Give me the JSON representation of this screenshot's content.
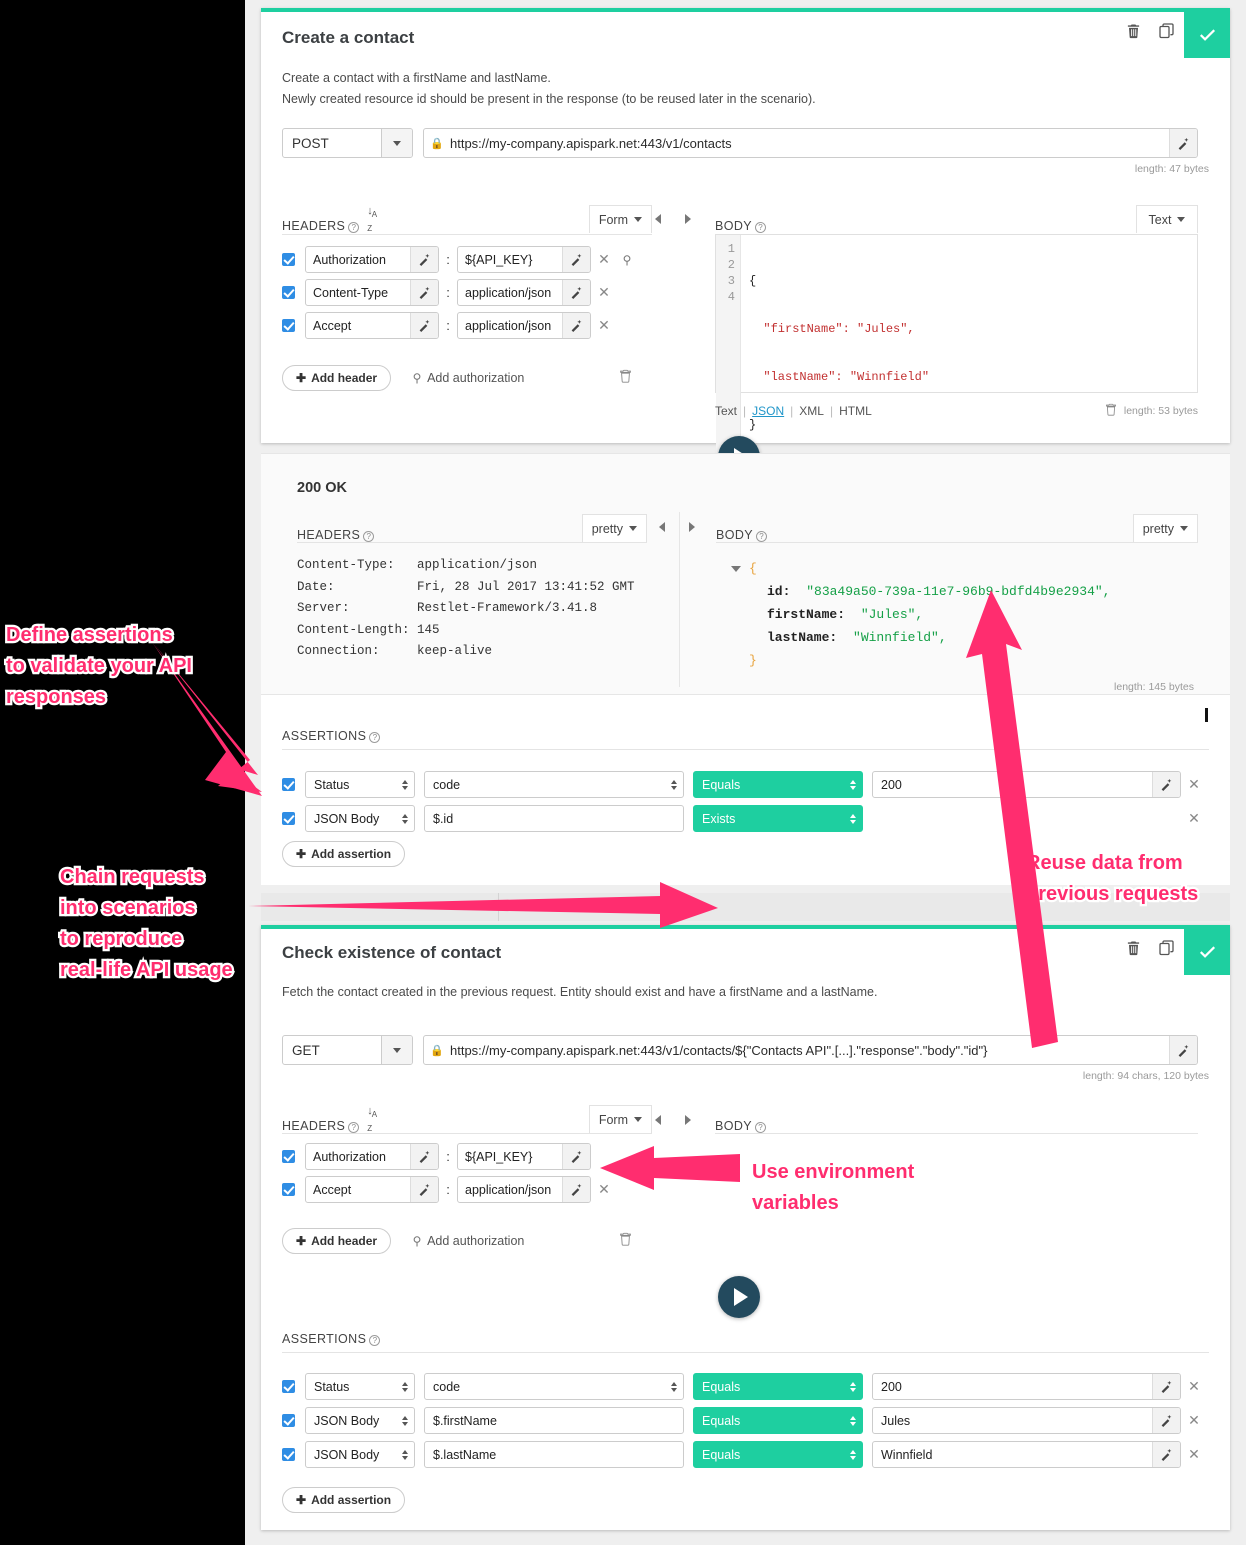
{
  "requests": [
    {
      "title": "Create a contact",
      "description_line1": "Create a contact with a firstName and lastName.",
      "description_line2": "Newly created resource id should be present in the response (to be reused later in the scenario).",
      "method": "POST",
      "url": "https://my-company.apispark.net:443/v1/contacts",
      "url_length_note": "length: 47 bytes",
      "headers_label": "HEADERS",
      "headers_mode": "Form",
      "headers": [
        {
          "checked": true,
          "name": "Authorization",
          "value": "${API_KEY}",
          "has_delete": true,
          "has_key_icon": true
        },
        {
          "checked": true,
          "name": "Content-Type",
          "value": "application/json",
          "has_delete": true,
          "has_key_icon": false
        },
        {
          "checked": true,
          "name": "Accept",
          "value": "application/json",
          "has_delete": true,
          "has_key_icon": false
        }
      ],
      "add_header_label": "Add header",
      "add_authorization_label": "Add authorization",
      "body_label": "BODY",
      "body_mode": "Text",
      "body_lines": [
        "{",
        "  \"firstName\": \"Jules\",",
        "  \"lastName\": \"Winnfield\"",
        "}"
      ],
      "body_line_numbers": [
        "1",
        "2",
        "3",
        "4"
      ],
      "body_formats": [
        "Text",
        "JSON",
        "XML",
        "HTML"
      ],
      "body_active_format": "JSON",
      "body_length_note": "length: 53 bytes",
      "response": {
        "status": "200 OK",
        "headers_label": "HEADERS",
        "headers_mode": "pretty",
        "headers": [
          {
            "name": "Content-Type:",
            "value": "application/json"
          },
          {
            "name": "Date:",
            "value": "Fri, 28 Jul 2017 13:41:52 GMT"
          },
          {
            "name": "Server:",
            "value": "Restlet-Framework/3.41.8"
          },
          {
            "name": "Content-Length:",
            "value": "145"
          },
          {
            "name": "Connection:",
            "value": "keep-alive"
          }
        ],
        "body_label": "BODY",
        "body_mode": "pretty",
        "body_fields": [
          {
            "key": "id:",
            "value": "\"83a49a50-739a-11e7-96b9-bdfd4b9e2934\","
          },
          {
            "key": "firstName:",
            "value": "\"Jules\","
          },
          {
            "key": "lastName:",
            "value": "\"Winnfield\","
          }
        ],
        "body_open_brace": "{",
        "body_close_brace": "}",
        "body_length_note": "length: 145 bytes"
      },
      "assertions_label": "ASSERTIONS",
      "assertions": [
        {
          "checked": true,
          "source": "Status",
          "path": "code",
          "operator": "Equals",
          "value": "200",
          "has_value": true,
          "has_wand": true,
          "has_delete": true
        },
        {
          "checked": true,
          "source": "JSON Body",
          "path": "$.id",
          "operator": "Exists",
          "value": "",
          "has_value": false,
          "has_wand": false,
          "has_delete": true
        }
      ],
      "add_assertion_label": "Add assertion"
    },
    {
      "title": "Check existence of contact",
      "description_line1": "Fetch the contact created in the previous request. Entity should exist and have a firstName and a lastName.",
      "method": "GET",
      "url": "https://my-company.apispark.net:443/v1/contacts/${\"Contacts API\".[...].\"response\".\"body\".\"id\"}",
      "url_length_note": "length: 94 chars, 120 bytes",
      "headers_label": "HEADERS",
      "headers_mode": "Form",
      "headers": [
        {
          "checked": true,
          "name": "Authorization",
          "value": "${API_KEY}",
          "has_delete": false,
          "has_key_icon": false
        },
        {
          "checked": true,
          "name": "Accept",
          "value": "application/json",
          "has_delete": true,
          "has_key_icon": false
        }
      ],
      "add_header_label": "Add header",
      "add_authorization_label": "Add authorization",
      "body_label": "BODY",
      "assertions_label": "ASSERTIONS",
      "assertions": [
        {
          "checked": true,
          "source": "Status",
          "path": "code",
          "operator": "Equals",
          "value": "200",
          "has_value": true,
          "has_wand": true,
          "has_delete": true
        },
        {
          "checked": true,
          "source": "JSON Body",
          "path": "$.firstName",
          "operator": "Equals",
          "value": "Jules",
          "has_value": true,
          "has_wand": true,
          "has_delete": true
        },
        {
          "checked": true,
          "source": "JSON Body",
          "path": "$.lastName",
          "operator": "Equals",
          "value": "Winnfield",
          "has_value": true,
          "has_wand": true,
          "has_delete": true
        }
      ],
      "add_assertion_label": "Add assertion"
    }
  ],
  "annotations": [
    {
      "id": "assertions-callout",
      "text": "Define assertions\nto validate your API\nresponses"
    },
    {
      "id": "chain-callout",
      "text": "Chain requests\ninto scenarios\nto reproduce\nreal-life API usage"
    },
    {
      "id": "reuse-callout",
      "text": "Reuse data from\nprevious requests"
    },
    {
      "id": "envvars-callout",
      "text": "Use environment\nvariables"
    }
  ],
  "colors": {
    "accent_teal": "#1ecfa0",
    "annotation_pink": "#ff2d6f",
    "play_navy": "#234a5e",
    "checkbox_blue": "#2f8de4"
  },
  "icons": {
    "delete": "trash-icon",
    "duplicate": "copy-icon",
    "confirm": "check-icon",
    "lock": "lock-icon",
    "wand": "magic-wand-icon",
    "sort": "sort-az-icon",
    "help": "help-icon",
    "play": "play-icon",
    "key": "key-icon"
  }
}
